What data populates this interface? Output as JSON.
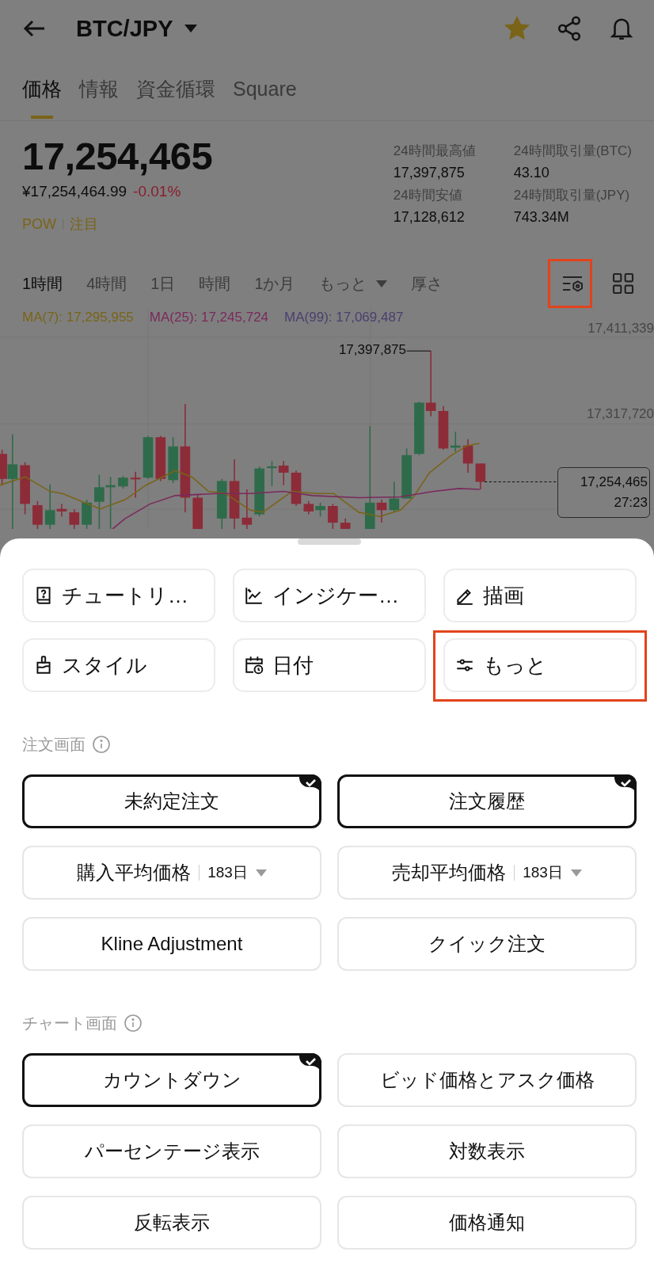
{
  "header": {
    "title": "BTC/JPY",
    "favorite": true
  },
  "tabs": [
    {
      "label": "価格",
      "selected": true
    },
    {
      "label": "情報",
      "selected": false
    },
    {
      "label": "資金循環",
      "selected": false
    },
    {
      "label": "Square",
      "selected": false
    }
  ],
  "price": {
    "last": "17,254,465",
    "fiat": "¥17,254,464.99",
    "change": "-0.01%",
    "tags": [
      "POW",
      "注目"
    ]
  },
  "stats": [
    {
      "label": "24時間最高値",
      "value": "17,397,875"
    },
    {
      "label": "24時間取引量(BTC)",
      "value": "43.10"
    },
    {
      "label": "24時間安値",
      "value": "17,128,612"
    },
    {
      "label": "24時間取引量(JPY)",
      "value": "743.34M"
    }
  ],
  "intervals": [
    {
      "label": "1時間",
      "kind": "option",
      "selected": true
    },
    {
      "label": "4時間",
      "kind": "option",
      "selected": false
    },
    {
      "label": "1日",
      "kind": "option",
      "selected": false
    },
    {
      "label": "時間",
      "kind": "option",
      "selected": false
    },
    {
      "label": "1か月",
      "kind": "option",
      "selected": false
    },
    {
      "label": "もっと",
      "kind": "dropdown",
      "selected": false
    },
    {
      "label": "厚さ",
      "kind": "option",
      "selected": false
    }
  ],
  "chart_toolbar": {
    "settings_highlighted": true
  },
  "moving_averages": [
    {
      "label": "MA(7): 17,295,955",
      "color": "#7a6418"
    },
    {
      "label": "MA(25): 17,245,724",
      "color": "#7b2a5c"
    },
    {
      "label": "MA(99): 17,069,487",
      "color": "#4a3f70"
    }
  ],
  "chart": {
    "axis_labels": [
      "17,411,339",
      "17,317,720"
    ],
    "high_marker": "17,397,875",
    "last_price": "17,254,465",
    "countdown": "27:23"
  },
  "tools": [
    {
      "label": "チュートリ…",
      "highlighted": false
    },
    {
      "label": "インジケー…",
      "highlighted": false
    },
    {
      "label": "描画",
      "highlighted": false
    },
    {
      "label": "スタイル",
      "highlighted": false
    },
    {
      "label": "日付",
      "highlighted": false
    },
    {
      "label": "もっと",
      "highlighted": true
    }
  ],
  "sections": [
    {
      "title": "注文画面",
      "options": [
        {
          "label": "未約定注文",
          "kind": "toggle",
          "selected": true
        },
        {
          "label": "注文履歴",
          "kind": "toggle",
          "selected": true
        },
        {
          "label": "購入平均価格",
          "kind": "period",
          "period": "183日",
          "selected": false
        },
        {
          "label": "売却平均価格",
          "kind": "period",
          "period": "183日",
          "selected": false
        },
        {
          "label": "Kline Adjustment",
          "kind": "toggle",
          "selected": false
        },
        {
          "label": "クイック注文",
          "kind": "toggle",
          "selected": false
        }
      ]
    },
    {
      "title": "チャート画面",
      "options": [
        {
          "label": "カウントダウン",
          "kind": "toggle",
          "selected": true
        },
        {
          "label": "ビッド価格とアスク価格",
          "kind": "toggle",
          "selected": false
        },
        {
          "label": "パーセンテージ表示",
          "kind": "toggle",
          "selected": false
        },
        {
          "label": "対数表示",
          "kind": "toggle",
          "selected": false
        },
        {
          "label": "反転表示",
          "kind": "toggle",
          "selected": false
        },
        {
          "label": "価格通知",
          "kind": "toggle",
          "selected": false
        }
      ]
    }
  ]
}
